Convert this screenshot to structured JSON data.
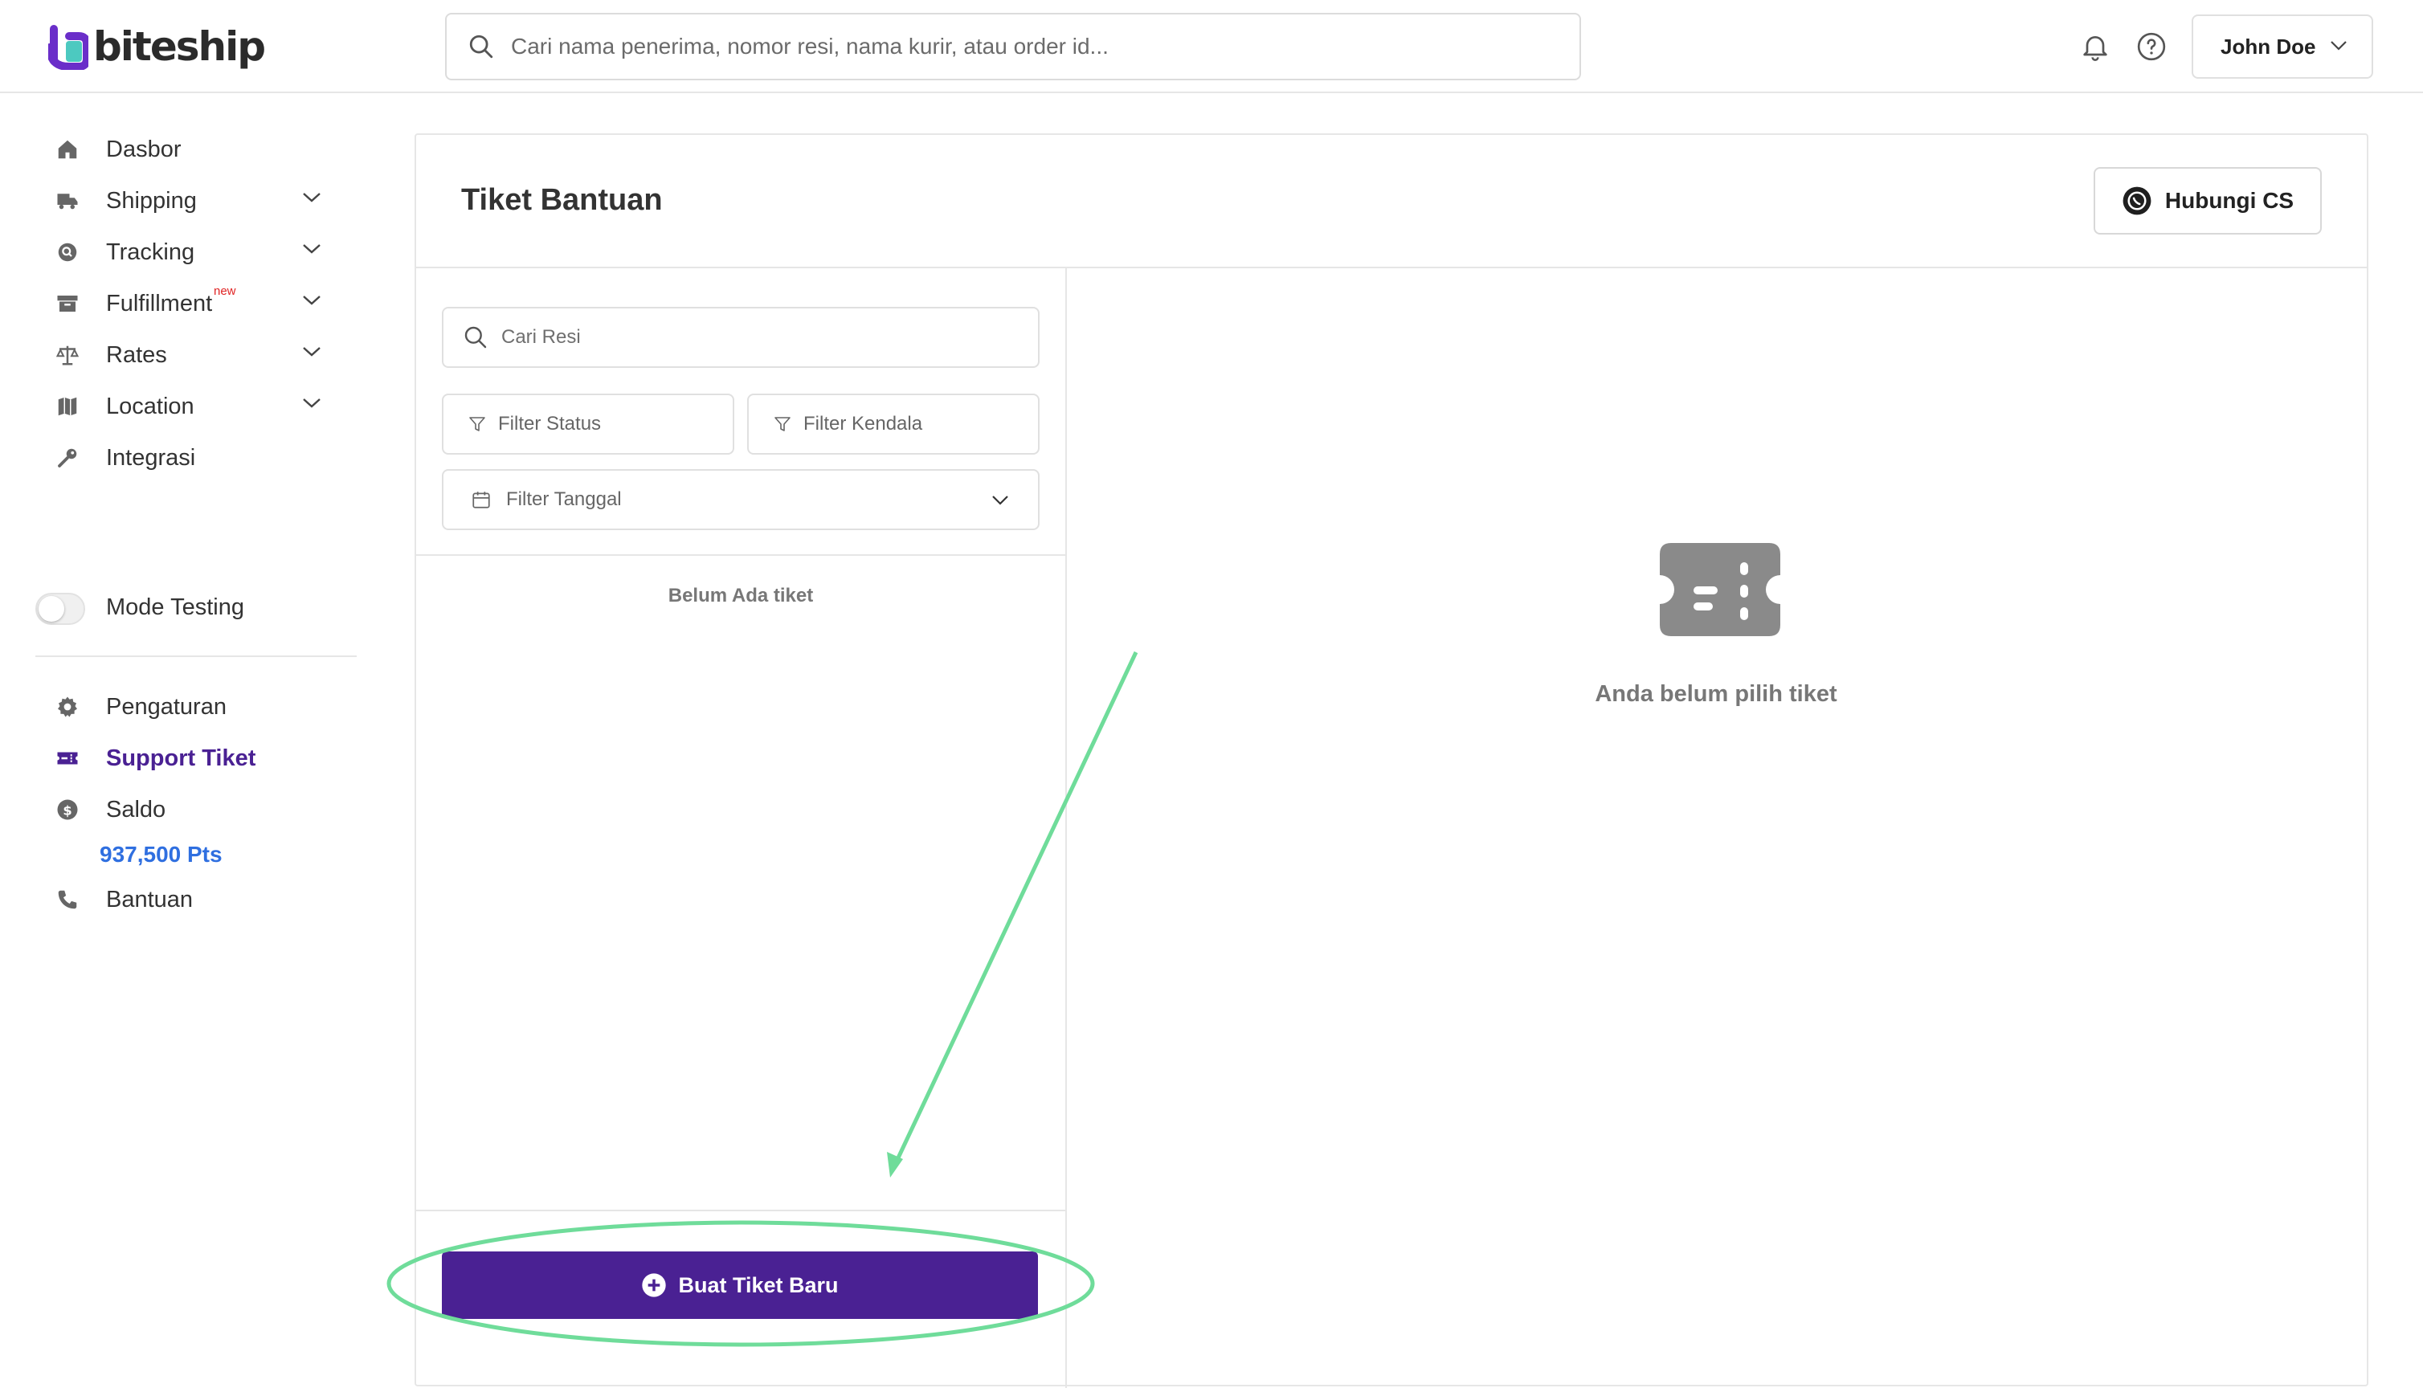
{
  "app": {
    "brand": "biteship"
  },
  "header": {
    "search_placeholder": "Cari nama penerima, nomor resi, nama kurir, atau order id...",
    "user_name": "John Doe"
  },
  "sidebar": {
    "items": [
      {
        "label": "Dasbor",
        "icon": "home-icon"
      },
      {
        "label": "Shipping",
        "icon": "truck-icon"
      },
      {
        "label": "Tracking",
        "icon": "tracking-icon"
      },
      {
        "label": "Fulfillment",
        "icon": "box-icon",
        "badge": "new"
      },
      {
        "label": "Rates",
        "icon": "scale-icon"
      },
      {
        "label": "Location",
        "icon": "map-icon"
      },
      {
        "label": "Integrasi",
        "icon": "key-icon"
      }
    ],
    "mode_testing_label": "Mode Testing",
    "bottom_items": [
      {
        "label": "Pengaturan",
        "icon": "gear-icon"
      },
      {
        "label": "Support Tiket",
        "icon": "ticket-icon"
      },
      {
        "label": "Saldo",
        "icon": "coin-icon"
      },
      {
        "label": "Bantuan",
        "icon": "phone-icon"
      }
    ],
    "points": "937,500 Pts"
  },
  "main": {
    "title": "Tiket Bantuan",
    "contact_cs_label": "Hubungi CS",
    "search_resi_placeholder": "Cari Resi",
    "filter_status": "Filter Status",
    "filter_kendala": "Filter Kendala",
    "filter_tanggal": "Filter Tanggal",
    "empty_list_text": "Belum Ada tiket",
    "empty_detail_text": "Anda belum pilih tiket",
    "create_button_label": "Buat Tiket Baru"
  },
  "colors": {
    "brand_purple": "#4a2193",
    "points_blue": "#2f6fe0",
    "annotation_green": "#6fdc9a"
  }
}
